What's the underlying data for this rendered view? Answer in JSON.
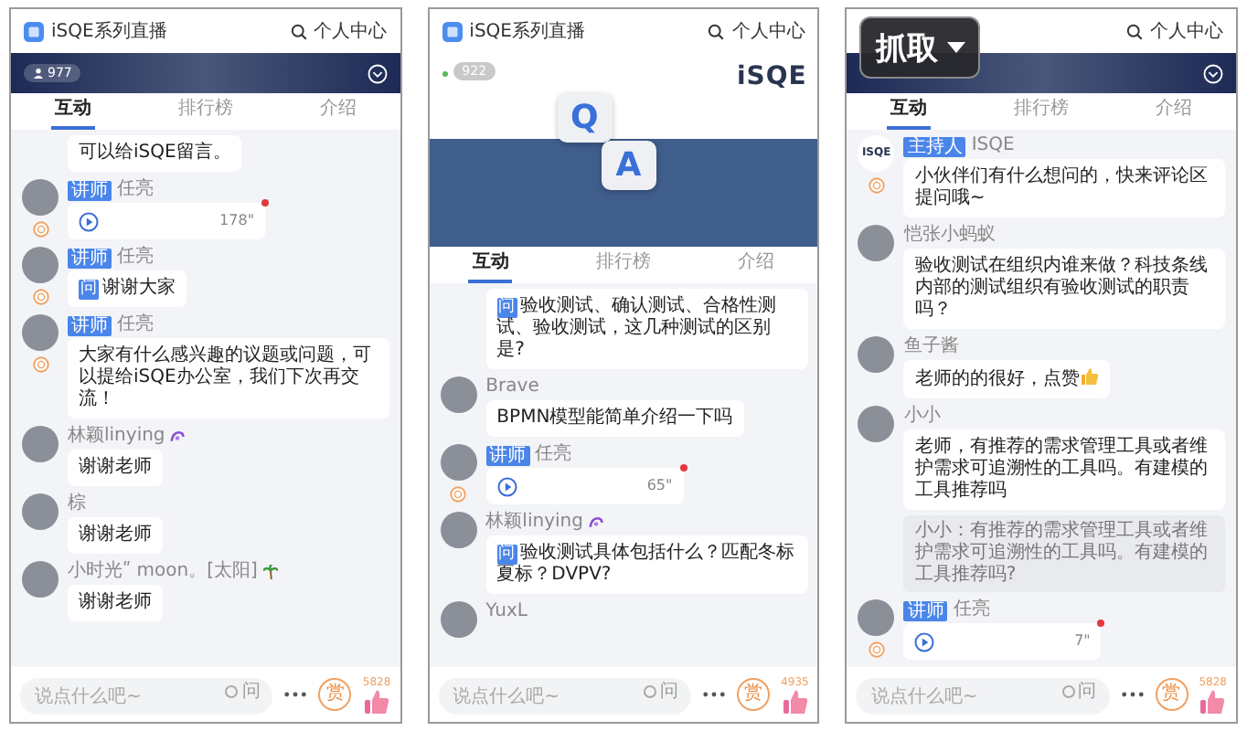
{
  "phones": [
    {
      "header": {
        "title": "iSQE系列直播",
        "account": "个人中心"
      },
      "banner": {
        "kind": "video",
        "viewers": "977"
      },
      "tabs": [
        {
          "label": "互动",
          "selected": true
        },
        {
          "label": "排行榜",
          "selected": false
        },
        {
          "label": "介绍",
          "selected": false
        }
      ],
      "messages": [
        {
          "kind": "text",
          "text": "可以给iSQE留言。"
        },
        {
          "kind": "voice",
          "avatar": true,
          "reward": true,
          "badge": "讲师",
          "name": "任亮",
          "duration": "178\"",
          "unread": true
        },
        {
          "kind": "text",
          "avatar": true,
          "reward": true,
          "badge": "讲师",
          "name": "任亮",
          "prefix": "问",
          "text": "谢谢大家"
        },
        {
          "kind": "text",
          "avatar": true,
          "reward": true,
          "badge": "讲师",
          "name": "任亮",
          "text": "大家有什么感兴趣的议题或问题，可以提给iSQE办公室，我们下次再交流！"
        },
        {
          "kind": "text",
          "avatar": true,
          "name": "林颖linying",
          "emoji": {
            "kind": "swirl"
          },
          "text": "谢谢老师"
        },
        {
          "kind": "text",
          "avatar": true,
          "name": "棕",
          "text": "谢谢老师"
        },
        {
          "kind": "text",
          "avatar": true,
          "name": "小时光ʺ moon。[太阳]",
          "emoji": {
            "kind": "palm"
          },
          "text": "谢谢老师"
        }
      ],
      "composer": {
        "placeholder": "说点什么吧~",
        "question_label": "问",
        "question_checked": false,
        "reward": "赏",
        "likes": "5828"
      }
    },
    {
      "header": {
        "title": "iSQE系列直播",
        "account": "个人中心"
      },
      "banner": {
        "kind": "qa",
        "viewers": "922",
        "brand": "iSQE",
        "letters": [
          "Q",
          "A"
        ]
      },
      "tabs": [
        {
          "label": "互动",
          "selected": true
        },
        {
          "label": "排行榜",
          "selected": false
        },
        {
          "label": "介绍",
          "selected": false
        }
      ],
      "messages": [
        {
          "kind": "text",
          "prefix": "问",
          "text": "验收测试、确认测试、合格性测试、验收测试，这几种测试的区别是?"
        },
        {
          "kind": "text",
          "avatar": true,
          "name": "Brave",
          "text": "BPMN模型能简单介绍一下吗"
        },
        {
          "kind": "voice",
          "avatar": true,
          "reward": true,
          "badge": "讲师",
          "name": "任亮",
          "duration": "65\"",
          "unread": true
        },
        {
          "kind": "text",
          "avatar": true,
          "name": "林颖linying",
          "emoji": {
            "kind": "swirl"
          },
          "prefix": "问",
          "text": "验收测试具体包括什么？匹配冬标夏标？DVPV?"
        },
        {
          "kind": "name-only",
          "avatar": true,
          "name": "YuxL"
        }
      ],
      "composer": {
        "placeholder": "说点什么吧~",
        "question_label": "问",
        "question_checked": false,
        "reward": "赏",
        "likes": "4935"
      }
    },
    {
      "header": {
        "account": "个人中心"
      },
      "overlay": {
        "label": "抓取"
      },
      "banner": {
        "kind": "video"
      },
      "tabs": [
        {
          "label": "互动",
          "selected": true
        },
        {
          "label": "排行榜",
          "selected": false
        },
        {
          "label": "介绍",
          "selected": false
        }
      ],
      "messages": [
        {
          "kind": "text",
          "avatar_text": "ISQE",
          "reward": true,
          "badge": "主持人",
          "name": "ISQE",
          "text": "小伙伴们有什么想问的，快来评论区提问哦~"
        },
        {
          "kind": "text",
          "avatar": true,
          "name": "恺张小蚂蚁",
          "text": "验收测试在组织内谁来做？科技条线内部的测试组织有验收测试的职责吗？"
        },
        {
          "kind": "text",
          "avatar": true,
          "name": "鱼子酱",
          "text": "老师的的很好，点赞",
          "trailing": {
            "kind": "thumbs"
          }
        },
        {
          "kind": "text",
          "avatar": true,
          "name": "小小",
          "text": "老师，有推荐的需求管理工具或者维护需求可追溯性的工具吗。有建模的工具推荐吗",
          "quote": "小小：有推荐的需求管理工具或者维护需求可追溯性的工具吗。有建模的工具推荐吗?"
        },
        {
          "kind": "voice",
          "avatar": true,
          "reward": true,
          "badge": "讲师",
          "name": "任亮",
          "duration": "7\"",
          "unread": true
        }
      ],
      "composer": {
        "placeholder": "说点什么吧~",
        "question_label": "问",
        "question_checked": false,
        "reward": "赏",
        "likes": "5828"
      }
    }
  ]
}
